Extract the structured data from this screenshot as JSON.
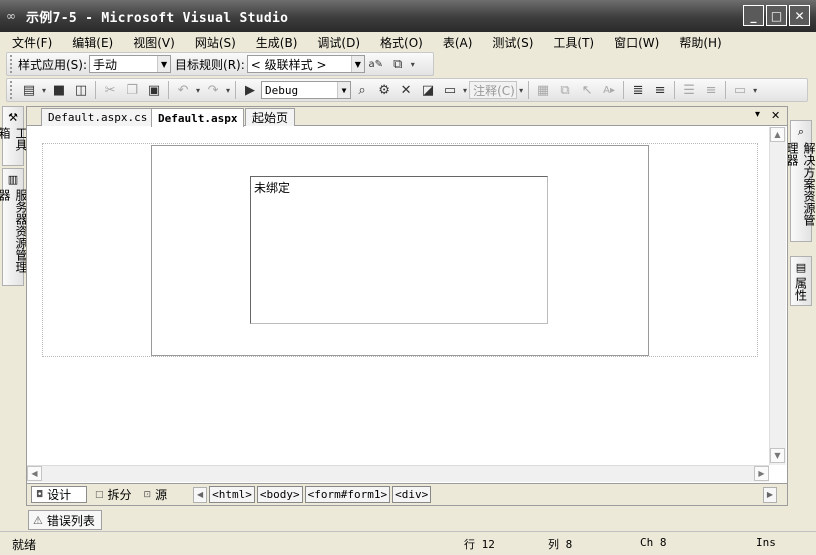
{
  "window": {
    "title": "示例7-5 - Microsoft Visual Studio",
    "controls": {
      "minimize": "_",
      "maximize": "□",
      "close": "✕"
    }
  },
  "menu": [
    "文件(F)",
    "编辑(E)",
    "视图(V)",
    "网站(S)",
    "生成(B)",
    "调试(D)",
    "格式(O)",
    "表(A)",
    "测试(S)",
    "工具(T)",
    "窗口(W)",
    "帮助(H)"
  ],
  "style_toolbar": {
    "style_apply_label": "样式应用(S):",
    "style_apply_value": "手动",
    "target_rule_label": "目标规则(R):",
    "target_rule_value": "< 级联样式 >"
  },
  "standard_toolbar": {
    "configuration": "Debug",
    "comment_combo": "注释(C)"
  },
  "left_rail": {
    "toolbox": "工具箱",
    "server_explorer": "服务器资源管理器"
  },
  "right_rail": {
    "solution_explorer": "解决方案资源管理器",
    "properties": "属性"
  },
  "document_tabs": [
    {
      "label": "Default.aspx.cs",
      "active": false
    },
    {
      "label": "Default.aspx",
      "active": true
    },
    {
      "label": "起始页",
      "active": false
    }
  ],
  "tab_controls": {
    "dropdown": "▾",
    "close": "✕"
  },
  "designer": {
    "gridview_placeholder": "未绑定"
  },
  "view_modes": {
    "design": "设计",
    "split": "拆分",
    "source": "源"
  },
  "breadcrumbs": [
    "<html>",
    "<body>",
    "<form#form1>",
    "<div>"
  ],
  "error_list_tab": "错误列表",
  "status": {
    "ready": "就绪",
    "line": "行 12",
    "column": "列 8",
    "char": "Ch 8",
    "mode": "Ins"
  }
}
